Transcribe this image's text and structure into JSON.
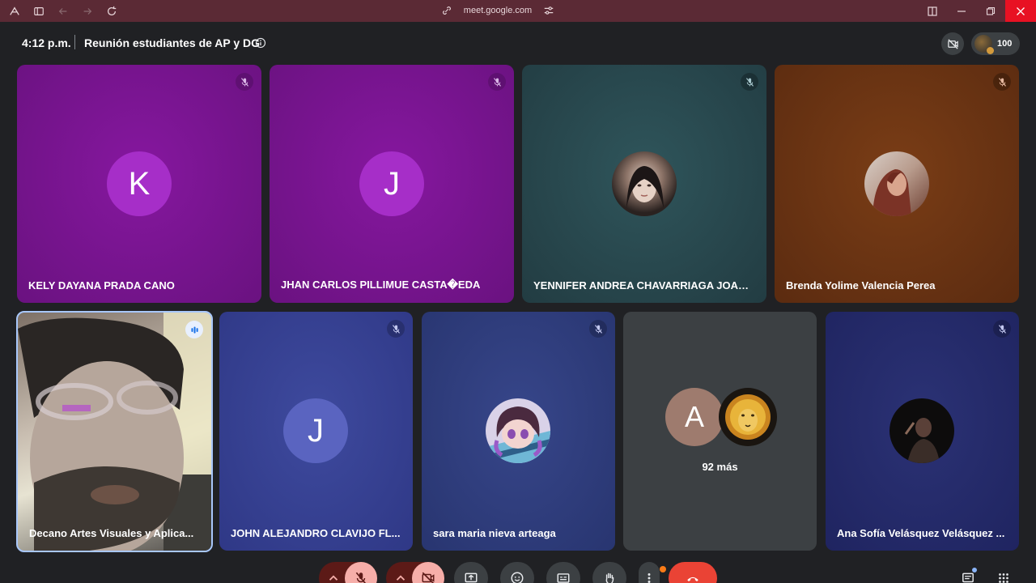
{
  "browser": {
    "url": "meet.google.com"
  },
  "meeting": {
    "time": "4:12 p.m.",
    "title": "Reunión estudiantes de AP y DG",
    "participant_count": "100"
  },
  "tiles_row1": [
    {
      "name": "KELY DAYANA PRADA CANO",
      "avatar_letter": "K",
      "bg": "#7a1696",
      "avatar_color": "#a62ec8"
    },
    {
      "name": "JHAN CARLOS PILLIMUE CASTA�EDA",
      "avatar_letter": "J",
      "bg": "#7a1696",
      "avatar_color": "#a62ec8"
    },
    {
      "name": "YENNIFER ANDREA CHAVARRIAGA JOAQUI",
      "avatar_icon": "profile-photo",
      "bg": "#2b4a50"
    },
    {
      "name": "Brenda Yolime Valencia Perea",
      "avatar_icon": "profile-photo",
      "bg": "#6a3414"
    }
  ],
  "tiles_row2": [
    {
      "name": "Decano Artes Visuales y Aplica...",
      "video_icon": "camera-feed",
      "speaking": true
    },
    {
      "name": "JOHN ALEJANDRO CLAVIJO FL...",
      "avatar_letter": "J",
      "bg": "#3a4394",
      "avatar_color": "#5a64c0"
    },
    {
      "name": "sara maria nieva arteaga",
      "avatar_icon": "anime-avatar",
      "bg": "#2f3f78"
    },
    {
      "more_label": "92 más",
      "avatar_letter": "A",
      "bg": "#3c4043",
      "avatar_color": "#9e7b6e"
    },
    {
      "name": "Ana Sofía Velásquez Velásquez ...",
      "avatar_icon": "profile-photo",
      "bg": "#262c66"
    }
  ],
  "controls": {
    "accent_red": "#ea4335",
    "muted_bg": "#f6aea9",
    "dark_red": "#5c1a17"
  }
}
